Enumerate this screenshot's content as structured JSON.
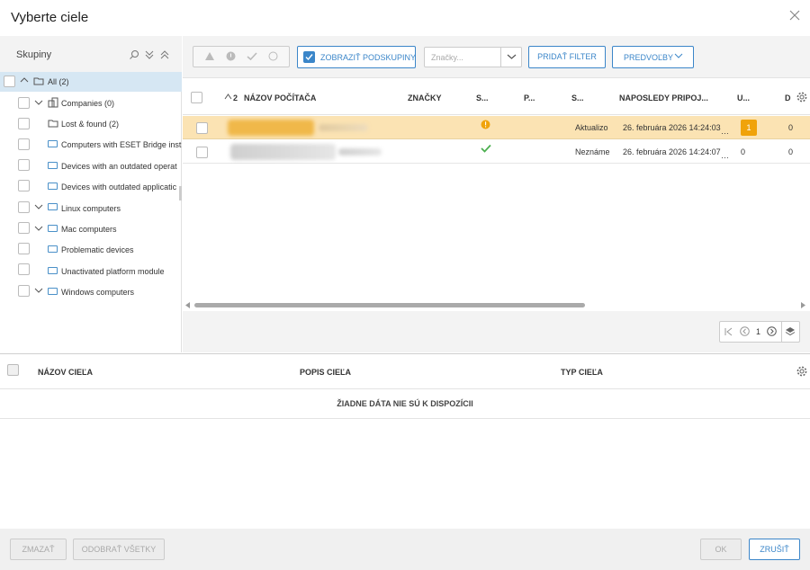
{
  "dialog": {
    "title": "Vyberte ciele"
  },
  "left": {
    "header": "Skupiny",
    "tree": [
      {
        "label": "All (2)"
      },
      {
        "label": "Companies (0)"
      },
      {
        "label": "Lost & found (2)"
      },
      {
        "label": "Computers with ESET Bridge inst"
      },
      {
        "label": "Devices with an outdated operat"
      },
      {
        "label": "Devices with outdated applicatic"
      },
      {
        "label": "Linux computers"
      },
      {
        "label": "Mac computers"
      },
      {
        "label": "Problematic devices"
      },
      {
        "label": "Unactivated platform module"
      },
      {
        "label": "Windows computers"
      }
    ]
  },
  "toolbar": {
    "show_subgroups": "ZOBRAZIŤ PODSKUPINY",
    "tags_placeholder": "Značky...",
    "add_filter": "PRIDAŤ FILTER",
    "presets": "PREDVOĽBY"
  },
  "table": {
    "sort_indicator": "2",
    "headers": [
      "NÁZOV POČÍTAČA",
      "ZNAČKY",
      "S...",
      "P...",
      "S...",
      "NAPOSLEDY PRIPOJ...",
      "U...",
      "D"
    ],
    "rows": [
      {
        "status_text": "Aktualizo",
        "last_connected": "26. februára 2026 14:24:03",
        "updates": "1",
        "d": "0"
      },
      {
        "status_text": "Neznáme",
        "last_connected": "26. februára 2026 14:24:07",
        "updates": "0",
        "d": "0"
      }
    ]
  },
  "pager": {
    "page": "1"
  },
  "bottom": {
    "headers": [
      "NÁZOV CIEĽA",
      "POPIS CIEĽA",
      "TYP CIEĽA"
    ],
    "no_data": "ŽIADNE DÁTA NIE SÚ K DISPOZÍCII"
  },
  "footer": {
    "delete": "ZMAZAŤ",
    "remove_all": "ODOBRAŤ VŠETKY",
    "ok": "OK",
    "cancel": "ZRUŠIŤ"
  },
  "colors": {
    "accent": "#3b86c9",
    "warning": "#f0a30a",
    "ok": "#4caf50",
    "highlight_row": "#fbe3b3",
    "selected_tree": "#d6e7f3"
  }
}
